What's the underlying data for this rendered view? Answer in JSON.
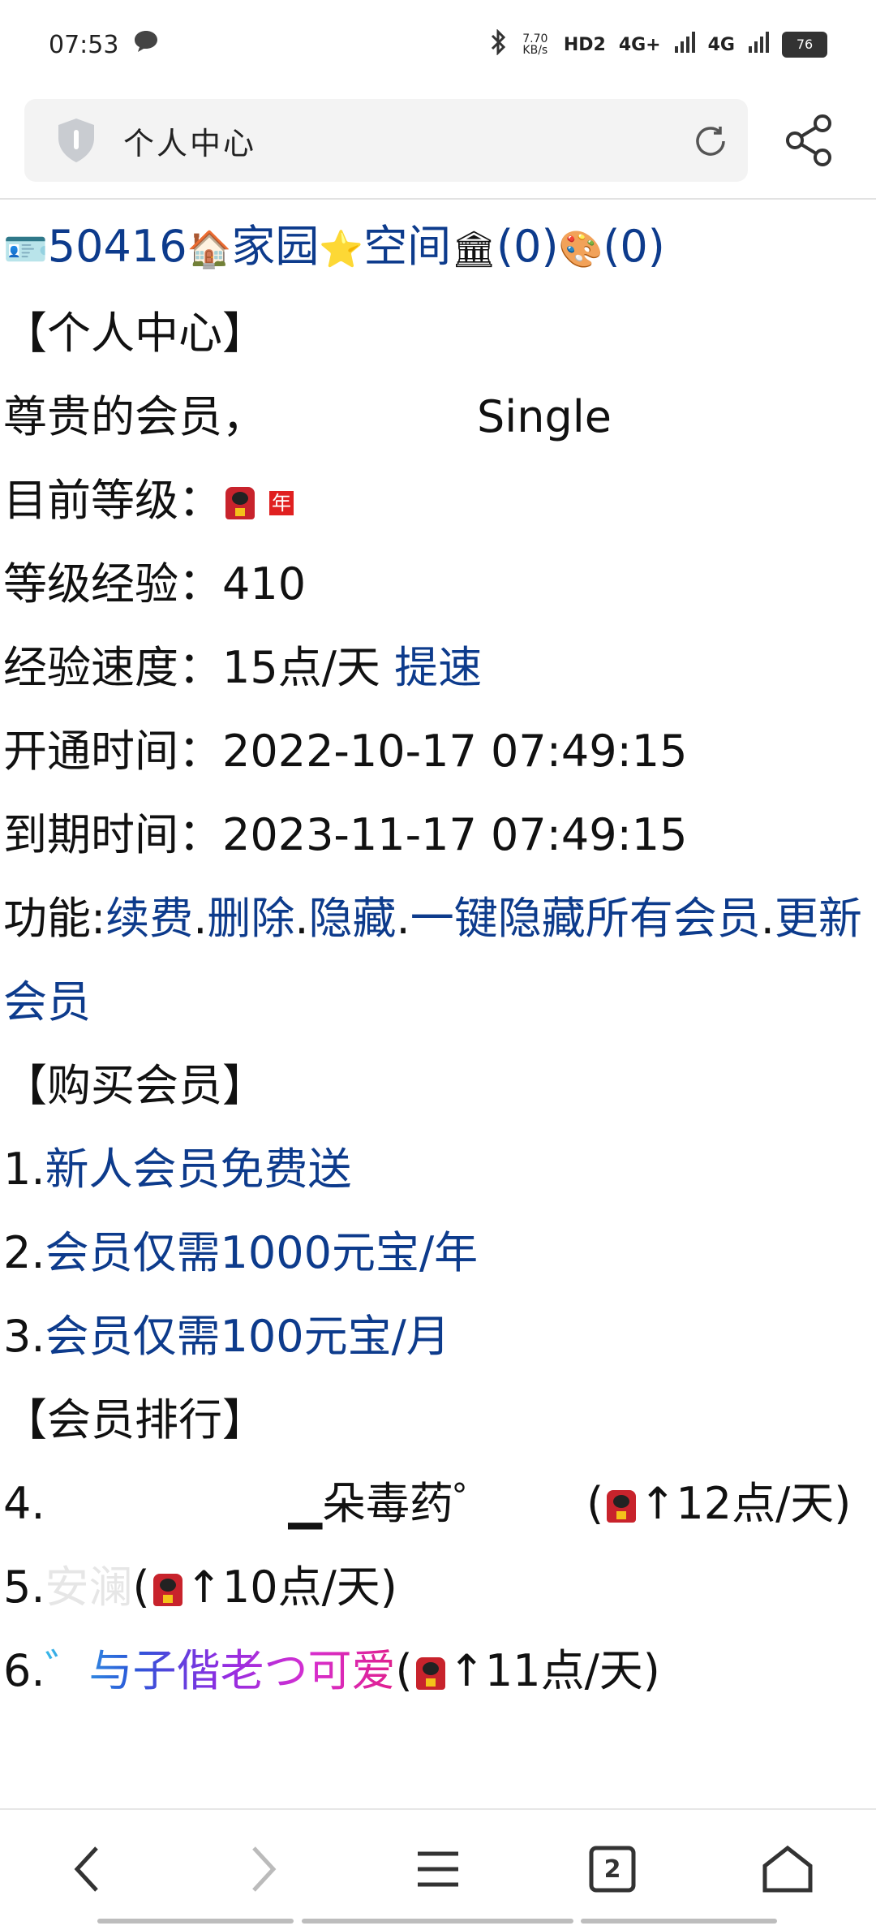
{
  "status_bar": {
    "time": "07:53",
    "net_speed": "7.70 KB/s",
    "hd": "HD2",
    "signal_1": "4G+",
    "signal_2": "4G",
    "battery": "76"
  },
  "address_bar": {
    "title": "个人中心"
  },
  "content": {
    "top_line": {
      "id": "50416",
      "home": "家园",
      "space": "空间",
      "count_a": "(0)",
      "count_b": "(0)"
    },
    "section_personal": "【个人中心】",
    "greeting_label": "尊贵的会员，",
    "greeting_name": "Single",
    "level_label": "目前等级：",
    "level_badge": "年",
    "exp_label": "等级经验：",
    "exp_value": "410",
    "speed_label": "经验速度：",
    "speed_value": "15点/天",
    "speed_link": "提速",
    "open_label": "开通时间：",
    "open_value": "2022-10-17 07:49:15",
    "expire_label": "到期时间：",
    "expire_value": "2023-11-17 07:49:15",
    "functions_label": "功能:",
    "functions": [
      "续费",
      "删除",
      "隐藏",
      "一键隐藏所有会员",
      "更新会员"
    ],
    "section_buy": "【购买会员】",
    "buy_items": [
      {
        "num": "1.",
        "text": "新人会员免费送"
      },
      {
        "num": "2.",
        "text": "会员仅需1000元宝/年"
      },
      {
        "num": "3.",
        "text": "会员仅需100元宝/月"
      }
    ],
    "section_rank": "【会员排行】",
    "rank_items": [
      {
        "num": "4.",
        "name": "▁朵毒药゜",
        "rate": "↑12点/天)"
      },
      {
        "num": "5.",
        "name": "安澜",
        "rate": "↑10点/天)"
      },
      {
        "num": "6.",
        "name": "゛与子偕老つ可爱",
        "rate": "↑11点/天)"
      }
    ]
  },
  "bottom_nav": {
    "tabs_count": "2"
  }
}
